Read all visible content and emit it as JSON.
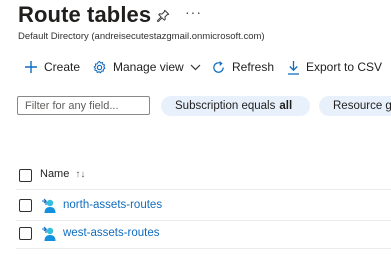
{
  "header": {
    "title": "Route tables",
    "more_label": "···",
    "subtitle": "Default Directory (andreisecutestazgmail.onmicrosoft.com)"
  },
  "toolbar": {
    "create_label": "Create",
    "manage_view_label": "Manage view",
    "refresh_label": "Refresh",
    "export_label": "Export to CSV"
  },
  "filters": {
    "search_placeholder": "Filter for any field...",
    "subscription_prefix": "Subscription equals",
    "subscription_value": "all",
    "resource_pill_label": "Resource g"
  },
  "table": {
    "name_header": "Name",
    "sort_indicator": "↑↓",
    "rows": [
      {
        "name": "north-assets-routes"
      },
      {
        "name": "west-assets-routes"
      }
    ]
  },
  "colors": {
    "accent": "#0f6cbd",
    "pill_bg": "#e8f1fb"
  }
}
